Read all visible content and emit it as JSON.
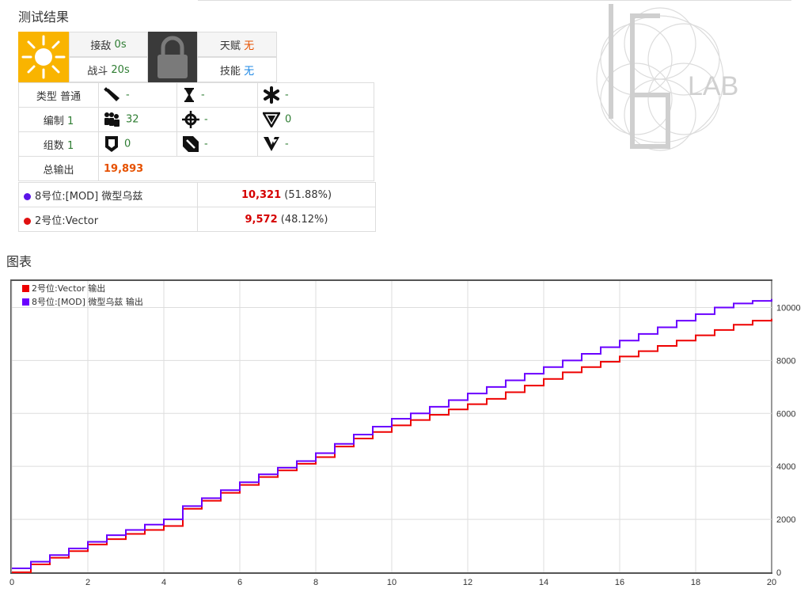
{
  "result": {
    "title": "测试结果",
    "engage_label": "接敌",
    "engage_value": "0s",
    "battle_label": "战斗",
    "battle_value": "20s",
    "talent_label": "天赋",
    "talent_value": "无",
    "skill_label": "技能",
    "skill_value": "无"
  },
  "stats": {
    "type_label": "类型",
    "type_value": "普通",
    "formation_label": "编制",
    "formation_value": "1",
    "groups_label": "组数",
    "groups_value": "1",
    "total_label": "总输出",
    "total_value": "19,893",
    "ammo": "-",
    "hourglass": "-",
    "asterisk": "-",
    "squad": "32",
    "crosshair": "-",
    "armor_pierce": "0",
    "shield": "0",
    "dodge": "-",
    "victory": "-"
  },
  "contributors": [
    {
      "name": "8号位:[MOD] 微型乌兹",
      "damage": "10,321",
      "pct": "(51.88%)",
      "color": "#5b14e8"
    },
    {
      "name": "2号位:Vector",
      "damage": "9,572",
      "pct": "(48.12%)",
      "color": "#e01010"
    }
  ],
  "chart": {
    "title": "图表"
  },
  "chart_data": {
    "type": "line",
    "x_range": [
      0,
      20
    ],
    "y_range": [
      0,
      11000
    ],
    "x_ticks": [
      0,
      2,
      4,
      6,
      8,
      10,
      12,
      14,
      16,
      18,
      20
    ],
    "y_ticks": [
      0,
      2000,
      4000,
      6000,
      8000,
      10000
    ],
    "grid": true,
    "legend_position": "top-left",
    "series": [
      {
        "name": "2号位:Vector 输出",
        "color": "#ee0000",
        "x": [
          0,
          0.5,
          1,
          1.5,
          2,
          2.5,
          3,
          3.5,
          4,
          4.5,
          5,
          5.5,
          6,
          6.5,
          7,
          7.5,
          8,
          8.5,
          9,
          9.5,
          10,
          10.5,
          11,
          11.5,
          12,
          12.5,
          13,
          13.5,
          14,
          14.5,
          15,
          15.5,
          16,
          16.5,
          17,
          17.5,
          18,
          18.5,
          19,
          19.5,
          20
        ],
        "y": [
          0,
          300,
          550,
          800,
          1050,
          1250,
          1450,
          1600,
          1750,
          2400,
          2700,
          3000,
          3300,
          3600,
          3850,
          4100,
          4350,
          4750,
          5050,
          5300,
          5550,
          5750,
          5950,
          6150,
          6350,
          6550,
          6800,
          7050,
          7300,
          7550,
          7750,
          7950,
          8150,
          8350,
          8550,
          8750,
          8950,
          9150,
          9350,
          9500,
          9572
        ]
      },
      {
        "name": "8号位:[MOD] 微型乌兹 输出",
        "color": "#6a00ff",
        "x": [
          0,
          0.5,
          1,
          1.5,
          2,
          2.5,
          3,
          3.5,
          4,
          4.5,
          5,
          5.5,
          6,
          6.5,
          7,
          7.5,
          8,
          8.5,
          9,
          9.5,
          10,
          10.5,
          11,
          11.5,
          12,
          12.5,
          13,
          13.5,
          14,
          14.5,
          15,
          15.5,
          16,
          16.5,
          17,
          17.5,
          18,
          18.5,
          19,
          19.5,
          20
        ],
        "y": [
          150,
          400,
          650,
          900,
          1150,
          1400,
          1600,
          1800,
          2000,
          2500,
          2800,
          3100,
          3400,
          3700,
          3950,
          4200,
          4500,
          4850,
          5200,
          5500,
          5800,
          6000,
          6250,
          6500,
          6750,
          7000,
          7250,
          7500,
          7750,
          8000,
          8250,
          8500,
          8750,
          9000,
          9250,
          9500,
          9750,
          10000,
          10150,
          10250,
          10321
        ]
      }
    ]
  }
}
